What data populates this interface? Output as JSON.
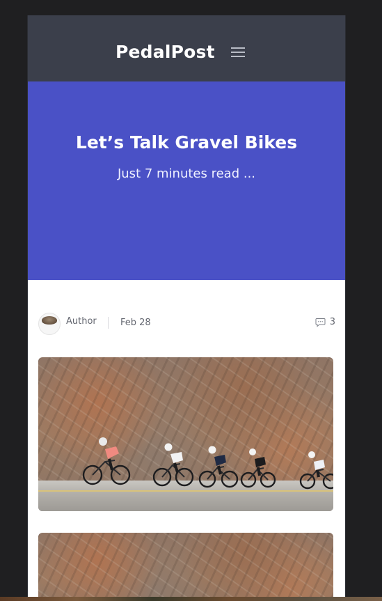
{
  "nav": {
    "brand": "PedalPost",
    "menu_icon": "hamburger-menu-icon"
  },
  "hero": {
    "title": "Let’s Talk Gravel Bikes",
    "subtitle": "Just 7 minutes read ..."
  },
  "post_meta": {
    "author": "Author",
    "date": "Feb 28",
    "comment_icon": "comment-bubble-icon",
    "comment_count": "3"
  },
  "colors": {
    "nav_bg": "#3b3f4b",
    "hero_bg": "#4a51c6",
    "page_bg": "#1f1f21"
  },
  "images": [
    {
      "alt": "cyclists riding past rock wall",
      "icon": "photo"
    },
    {
      "alt": "rock wall",
      "icon": "photo"
    }
  ]
}
